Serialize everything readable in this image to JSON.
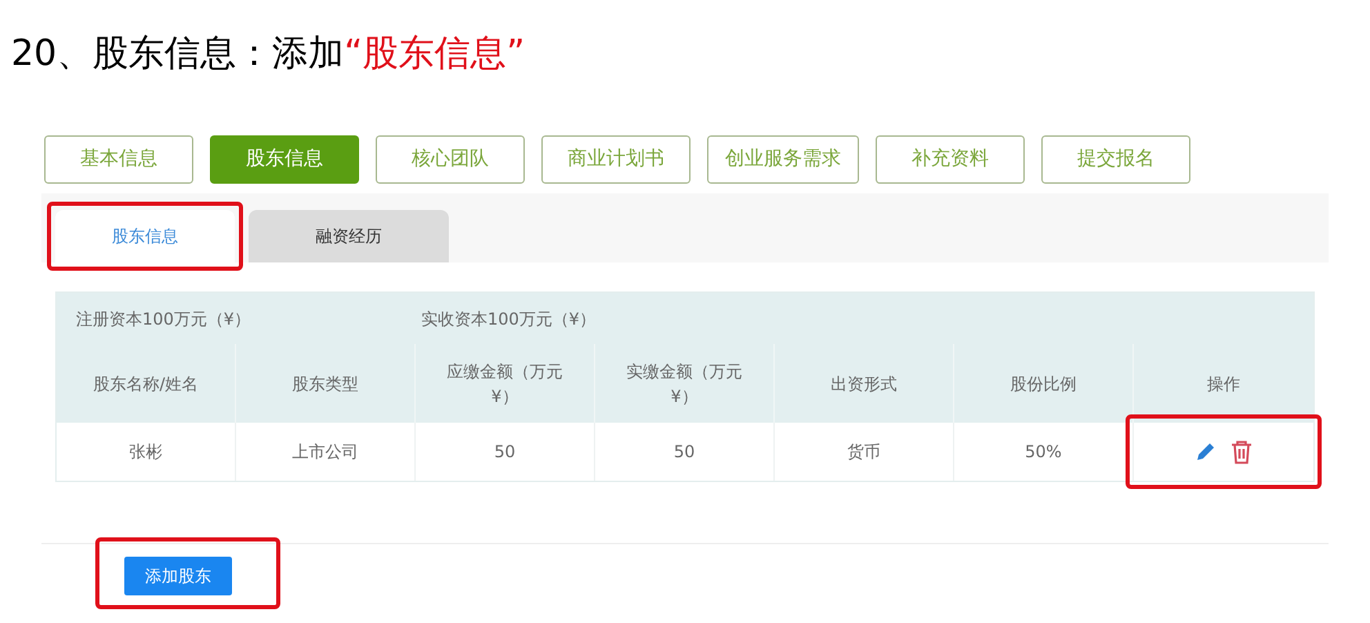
{
  "heading": {
    "text": "20、股东信息：添加",
    "emphasis": "“股东信息”"
  },
  "tabs": [
    {
      "label": "基本信息",
      "selected": false
    },
    {
      "label": "股东信息",
      "selected": true
    },
    {
      "label": "核心团队",
      "selected": false
    },
    {
      "label": "商业计划书",
      "selected": false
    },
    {
      "label": "创业服务需求",
      "selected": false
    },
    {
      "label": "补充资料",
      "selected": false
    },
    {
      "label": "提交报名",
      "selected": false
    }
  ],
  "sub_tabs": [
    {
      "label": "股东信息",
      "selected": true,
      "highlighted": true
    },
    {
      "label": "融资经历",
      "selected": false,
      "highlighted": false
    }
  ],
  "table": {
    "summary": [
      "注册资本100万元（¥）",
      "实收资本100万元（¥）"
    ],
    "columns": [
      "股东名称/姓名",
      "股东类型",
      "应缴金额（万元¥）",
      "实缴金额（万元¥）",
      "出资形式",
      "股份比例",
      "操作"
    ],
    "rows": [
      {
        "cells": [
          "张彬",
          "上市公司",
          "50",
          "50",
          "货币",
          "50%"
        ],
        "actions_highlighted": true
      }
    ]
  },
  "add_button": {
    "label": "添加股东",
    "highlighted": true
  }
}
